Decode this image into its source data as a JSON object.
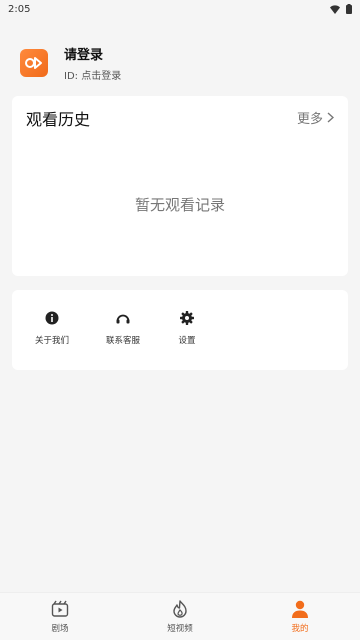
{
  "status_bar": {
    "time": "2:05"
  },
  "profile": {
    "name": "请登录",
    "id_text": "ID: 点击登录"
  },
  "history": {
    "title": "观看历史",
    "more": "更多",
    "empty": "暂无观看记录"
  },
  "services": [
    {
      "label": "关于我们",
      "icon": "info-icon"
    },
    {
      "label": "联系客服",
      "icon": "headset-icon"
    },
    {
      "label": "设置",
      "icon": "gear-icon"
    }
  ],
  "nav": [
    {
      "label": "剧场",
      "icon": "theater-icon",
      "active": false
    },
    {
      "label": "短视频",
      "icon": "flame-icon",
      "active": false
    },
    {
      "label": "我的",
      "icon": "user-icon",
      "active": true
    }
  ],
  "colors": {
    "accent": "#f26d1b",
    "background": "#f5f5f5"
  }
}
